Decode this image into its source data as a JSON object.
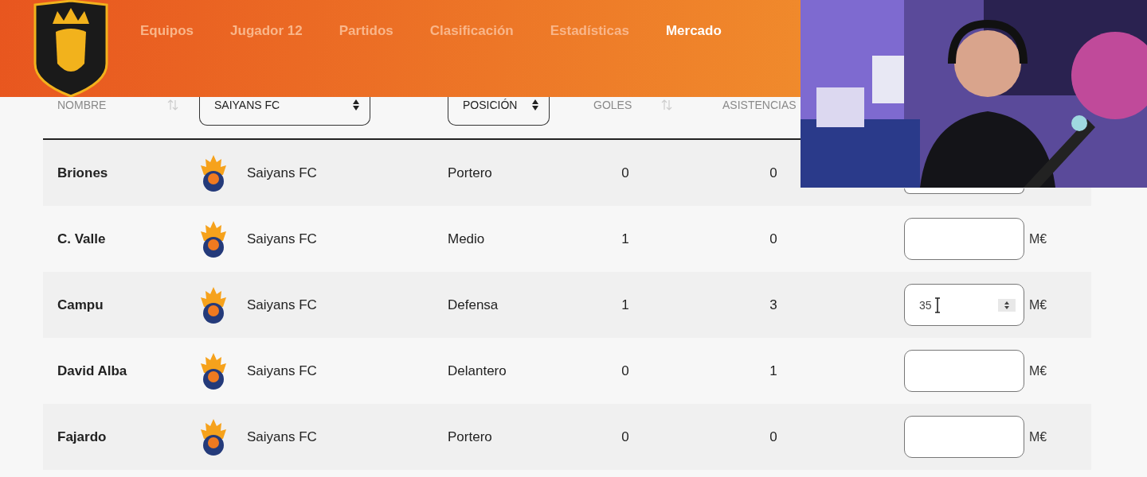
{
  "nav": {
    "items": [
      {
        "label": "Equipos",
        "selected": false
      },
      {
        "label": "Jugador 12",
        "selected": false
      },
      {
        "label": "Partidos",
        "selected": false
      },
      {
        "label": "Clasificación",
        "selected": false
      },
      {
        "label": "Estadísticas",
        "selected": false
      },
      {
        "label": "Mercado",
        "selected": true
      }
    ]
  },
  "table": {
    "columns": [
      {
        "kind": "sort",
        "label": "NOMBRE"
      },
      {
        "kind": "select",
        "label": "SAIYANS FC"
      },
      {
        "kind": "select",
        "label": "POSICIÓN"
      },
      {
        "kind": "sort",
        "label": "GOLES"
      },
      {
        "kind": "plain",
        "label": "ASISTENCIAS"
      }
    ],
    "rows": [
      {
        "kind": "covered",
        "name": "Briones",
        "team": "Saiyans FC",
        "position": "Portero",
        "goals": "0",
        "assists": "0",
        "hover": false
      },
      {
        "kind": "open",
        "name": "C. Valle",
        "team": "Saiyans FC",
        "position": "Medio",
        "goals": "1",
        "assists": "0",
        "unit": "M€",
        "hover": false
      },
      {
        "kind": "open",
        "name": "Campu",
        "team": "Saiyans FC",
        "position": "Defensa",
        "goals": "1",
        "assists": "3",
        "price": "35",
        "unit": "M€",
        "hover": true
      },
      {
        "kind": "open",
        "name": "David Alba",
        "team": "Saiyans FC",
        "position": "Delantero",
        "goals": "0",
        "assists": "1",
        "unit": "M€",
        "hover": false
      },
      {
        "kind": "open",
        "name": "Fajardo",
        "team": "Saiyans FC",
        "position": "Portero",
        "goals": "0",
        "assists": "0",
        "unit": "M€",
        "hover": false
      }
    ]
  }
}
